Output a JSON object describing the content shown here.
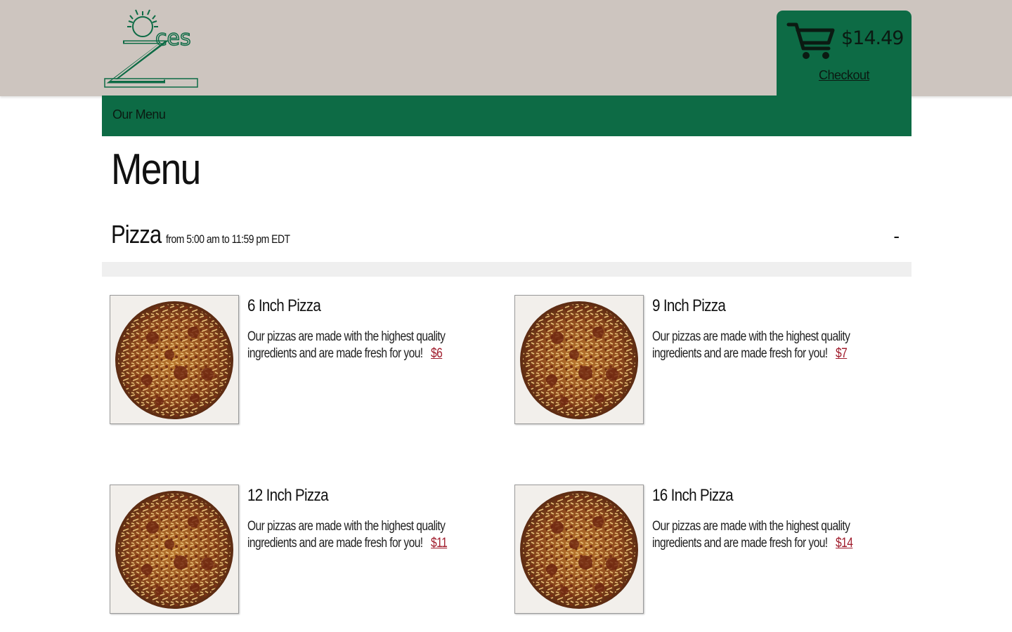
{
  "header": {
    "logo_text": "Zeces",
    "cart_total": "$14.49",
    "checkout_label": "Checkout"
  },
  "nav": {
    "items": [
      {
        "label": "Our Menu"
      }
    ]
  },
  "main": {
    "title": "Menu",
    "section": {
      "name": "Pizza",
      "hours": "from 5:00 am to 11:59 pm EDT",
      "toggle": "-"
    },
    "items": [
      {
        "name": "6 Inch Pizza",
        "description": "Our pizzas are made with the highest quality ingredients and are made fresh for you!",
        "price": "$6"
      },
      {
        "name": "9 Inch Pizza",
        "description": "Our pizzas are made with the highest quality ingredients and are made fresh for you!",
        "price": "$7"
      },
      {
        "name": "12 Inch Pizza",
        "description": "Our pizzas are made with the highest quality ingredients and are made fresh for you!",
        "price": "$11"
      },
      {
        "name": "16 Inch Pizza",
        "description": "Our pizzas are made with the highest quality ingredients and are made fresh for you!",
        "price": "$14"
      }
    ]
  },
  "colors": {
    "brand_green": "#0d6b45",
    "header_bg": "#cdc5bf",
    "price_red": "#a01c2c"
  },
  "icons": [
    "logo-icon",
    "cart-icon",
    "pizza-image"
  ]
}
